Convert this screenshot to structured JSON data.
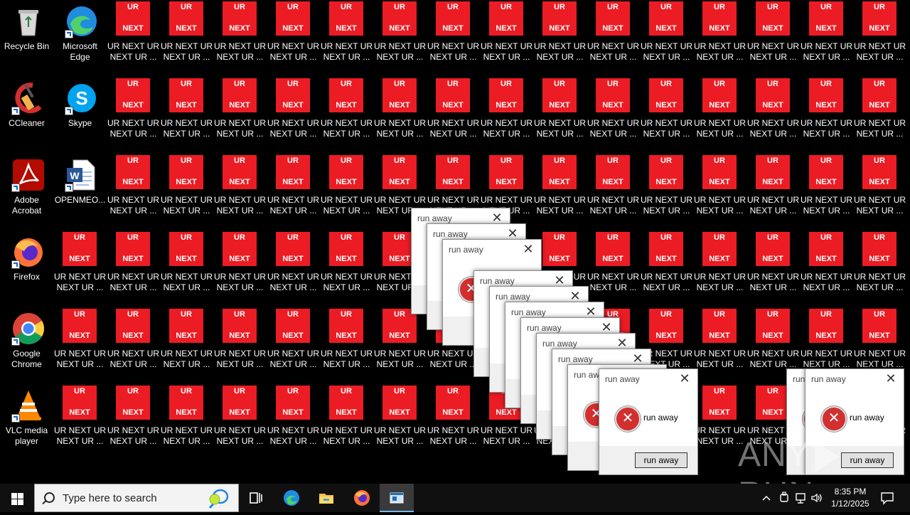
{
  "desktop": {
    "system_icons": [
      {
        "label": "Recycle Bin",
        "icon": "recycle-bin-icon"
      },
      {
        "label": "Microsoft Edge",
        "icon": "edge-icon"
      },
      {
        "label": "CCleaner",
        "icon": "ccleaner-icon"
      },
      {
        "label": "Skype",
        "icon": "skype-icon"
      },
      {
        "label": "Adobe Acrobat",
        "icon": "acrobat-icon"
      },
      {
        "label": "OPENMEO...",
        "icon": "word-document-icon"
      },
      {
        "label": "Firefox",
        "icon": "firefox-icon"
      },
      {
        "label": "Google Chrome",
        "icon": "chrome-icon"
      },
      {
        "label": "VLC media player",
        "icon": "vlc-icon"
      }
    ],
    "ur_icon": {
      "top_text": "UR",
      "bottom_text": "NEXT",
      "label": "UR NEXT UR NEXT UR ...",
      "color": "#ec1c24"
    }
  },
  "dialog": {
    "title": "run away",
    "message": "run away",
    "button": "run away",
    "close": "✕",
    "error_symbol": "✕"
  },
  "watermark": {
    "text_left": "ANY",
    "text_right": "RUN"
  },
  "taskbar": {
    "search_placeholder": "Type here to search",
    "time": "8:35 PM",
    "date": "1/12/2025",
    "pinned": [
      "task-view-icon",
      "edge-icon",
      "file-explorer-icon",
      "firefox-icon",
      "active-app-icon"
    ]
  }
}
